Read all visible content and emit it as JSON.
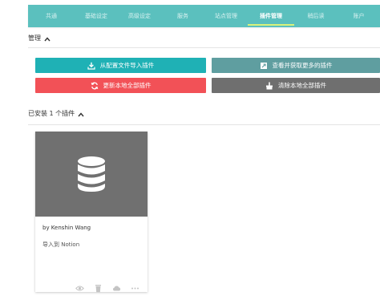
{
  "nav": {
    "tabs": [
      {
        "label": "共通"
      },
      {
        "label": "基础设定"
      },
      {
        "label": "高级设定"
      },
      {
        "label": "服务"
      },
      {
        "label": "站点管理"
      },
      {
        "label": "插件管理"
      },
      {
        "label": "稍后读"
      },
      {
        "label": "账户"
      }
    ],
    "active_tab": "插件管理"
  },
  "manage": {
    "title": "管理",
    "buttons": {
      "import": "从配置文件导入插件",
      "get_more": "查看并获取更多的插件",
      "update_all": "更新本地全部插件",
      "clear_all": "清除本地全部插件"
    }
  },
  "installed": {
    "title": "已安装 1 个插件",
    "plugins": [
      {
        "author": "by Kenshin Wang",
        "description": "导入到 Notion"
      }
    ]
  },
  "colors": {
    "nav_bg": "#5bc0be",
    "active_underline": "#d9f27a",
    "import_btn": "#1fb1b5",
    "get_more_btn": "#5f9ea0",
    "update_btn": "#f25157",
    "clear_btn": "#6f6f6f",
    "card_media": "#707070"
  }
}
